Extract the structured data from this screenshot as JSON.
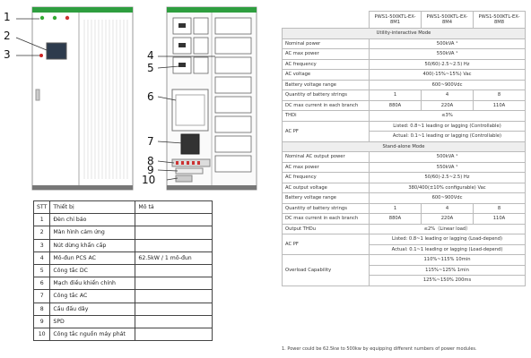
{
  "callouts": [
    "1",
    "2",
    "3",
    "4",
    "5",
    "6",
    "7",
    "8",
    "9",
    "10"
  ],
  "parts_table": {
    "headers": [
      "STT",
      "Thiết bị",
      "Mô tả"
    ],
    "rows": [
      [
        "1",
        "Đèn chỉ báo",
        ""
      ],
      [
        "2",
        "Màn hình cảm ứng",
        ""
      ],
      [
        "3",
        "Nút dừng khẩn cấp",
        ""
      ],
      [
        "4",
        "Mô-đun PCS AC",
        "62.5kW / 1 mô-đun"
      ],
      [
        "5",
        "Công tắc DC",
        ""
      ],
      [
        "6",
        "Mạch điều khiển chính",
        ""
      ],
      [
        "7",
        "Công tắc AC",
        ""
      ],
      [
        "8",
        "Cầu đấu dây",
        ""
      ],
      [
        "9",
        "SPD",
        ""
      ],
      [
        "10",
        "Công tắc nguồn máy phát",
        ""
      ]
    ]
  },
  "spec": {
    "models": [
      "PWS1-500KTL-EX-8M1",
      "PWS1-500KTL-EX-8M4",
      "PWS1-500KTL-EX-8M8"
    ],
    "sec_grid": "Utility-interactive Mode",
    "grid": {
      "nominal_power": [
        "Nominal power",
        "500kVA ¹"
      ],
      "ac_max_power": [
        "AC max power",
        "550kVA ¹"
      ],
      "ac_frequency": [
        "AC frequency",
        "50/60(-2.5~2.5) Hz"
      ],
      "ac_voltage": [
        "AC voltage",
        "400(-15%~15%) Vac"
      ],
      "battery_range": [
        "Battery voltage range",
        "600~900Vdc"
      ],
      "battery_strings": [
        "Quantity of battery strings",
        "1",
        "4",
        "8"
      ],
      "dc_max_current": [
        "DC max current in each branch",
        "880A",
        "220A",
        "110A"
      ],
      "thdi": [
        "THDi",
        "≤3%"
      ],
      "ac_pf_label": "AC PF",
      "ac_pf_1": "Listed: 0.8~1 leading or lagging (Controllable)",
      "ac_pf_2": "Actual: 0.1~1 leading or lagging (Controllable)"
    },
    "sec_standalone": "Stand-alone Mode",
    "standalone": {
      "nominal_output": [
        "Nominal AC output power",
        "500kVA ¹"
      ],
      "ac_max_power": [
        "AC max power",
        "550kVA ¹"
      ],
      "ac_frequency": [
        "AC frequency",
        "50/60(-2.5~2.5) Hz"
      ],
      "ac_output_voltage": [
        "AC output voltage",
        "380/400(±10% configurable) Vac"
      ],
      "battery_range": [
        "Battery voltage range",
        "600~900Vdc"
      ],
      "battery_strings": [
        "Quantity of battery strings",
        "1",
        "4",
        "8"
      ],
      "dc_max_current": [
        "DC max current in each branch",
        "880A",
        "220A",
        "110A"
      ],
      "thdu": [
        "Output THDu",
        "≤2%（Linear load）"
      ],
      "ac_pf_label": "AC PF",
      "ac_pf_1": "Listed: 0.8~1 leading or lagging (Load-depend)",
      "ac_pf_2": "Actual: 0.1~1 leading or lagging (Load-depend)",
      "overload_label": "Overload Capability",
      "overload_1": "110%~115%  10min",
      "overload_2": "115%~125%  1min",
      "overload_3": "125%~150%  200ms"
    },
    "footnote": "1.  Power could be 62.5kw to 500kw by equipping different numbers of power modules."
  }
}
